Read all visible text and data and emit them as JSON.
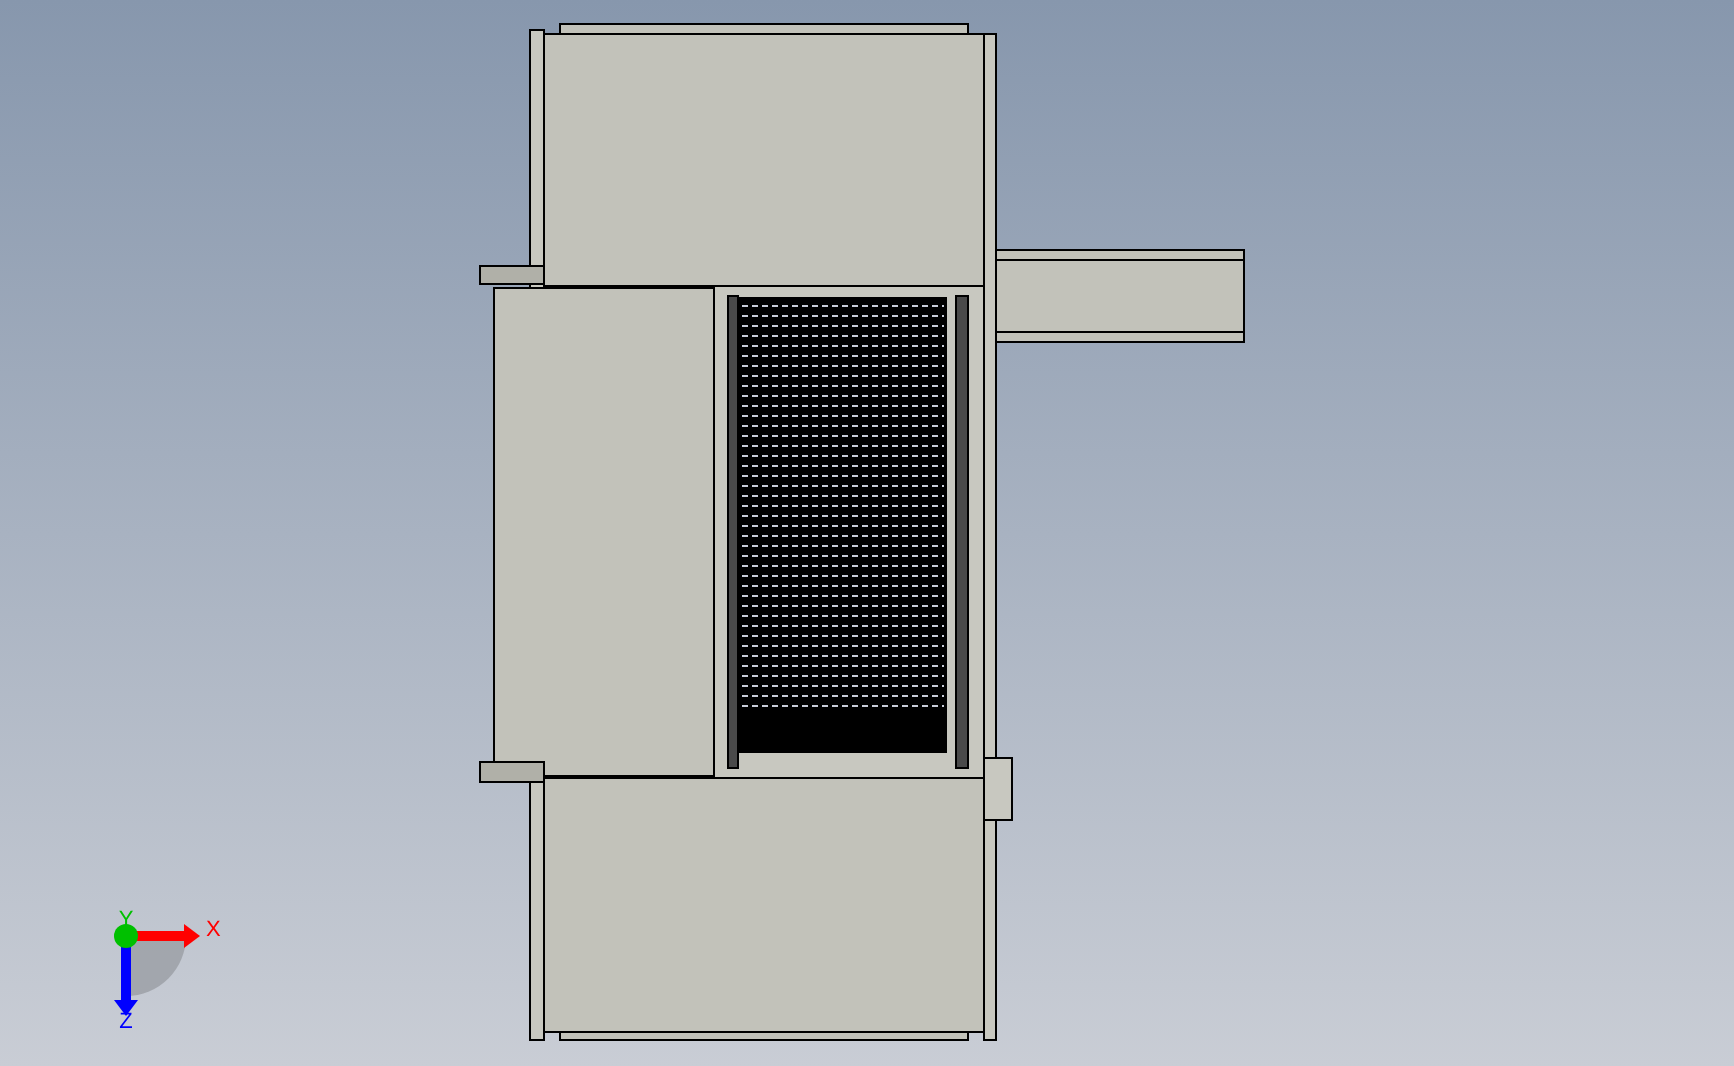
{
  "viewport": {
    "triad": {
      "axes": [
        {
          "label": "X",
          "color": "#ff0000"
        },
        {
          "label": "Y",
          "color": "#00c000"
        },
        {
          "label": "Z",
          "color": "#0000ff"
        }
      ]
    }
  }
}
